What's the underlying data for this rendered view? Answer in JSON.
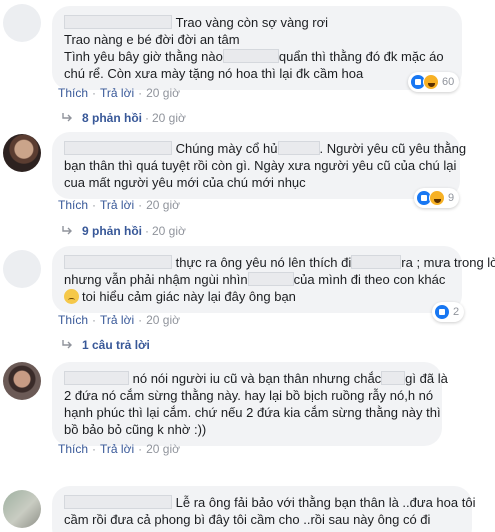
{
  "colors": {
    "link": "#385898",
    "meta": "#90949c",
    "bubble": "#f2f3f5",
    "like_blue": "#1877f2",
    "haha_yellow": "#f7b125"
  },
  "comments": [
    {
      "lines": [
        "Trao vàng còn sợ vàng rơi",
        "Trao nàng e bé đời đời an tâm",
        "Tình yêu bây giờ thằng nào",
        "quẩn thì thằng đó đk mặc áo",
        "chú rể. Còn xưa mày tặng nó hoa thì lại đk cầm hoa"
      ],
      "like": "Thích",
      "reply": "Trả lời",
      "time": "20 giờ",
      "reactions": "60",
      "replies_label": "8 phản hồi",
      "replies_time": "20 giờ"
    },
    {
      "lines": [
        "Chúng mày cổ hủ",
        ". Người yêu cũ yêu thằng",
        "bạn thân thì quá tuyệt rồi còn gì. Ngày xưa người yêu cũ của chú lại",
        "cua mất người yêu mới của chú mới nhục"
      ],
      "like": "Thích",
      "reply": "Trả lời",
      "time": "20 giờ",
      "reactions": "9",
      "replies_label": "9 phản hồi",
      "replies_time": "20 giờ"
    },
    {
      "lines": [
        "thực ra ông yêu nó lên thích đi",
        "ra ; mưa trong lòng",
        "nhưng vẫn phải nhậm ngùi nhìn",
        "của mình đi theo con khác",
        "toi hiểu cảm giác này lại đây ông bạn"
      ],
      "like": "Thích",
      "reply": "Trả lời",
      "time": "20 giờ",
      "reactions": "2",
      "replies_label": "1 câu trả lời"
    },
    {
      "lines": [
        "nó nói người iu cũ và bạn thân nhưng chắc",
        "gì đã là",
        "2 đứa nó cắm sừng thằng này. hay lại bồ bịch ruồng rẫy nó,h nó",
        "hạnh phúc thì lại cắm. chứ nếu 2 đứa kia cắm sừng thằng này thì",
        "bồ bảo bỏ cũng k nhờ :))"
      ],
      "like": "Thích",
      "reply": "Trả lời",
      "time": "20 giờ"
    },
    {
      "lines": [
        "Lễ ra ông fải bảo với thằng bạn thân là ..đưa hoa tôi",
        "cầm rồi đưa cả phong bì đây tôi cầm cho ..rồi sau này ông có đi"
      ]
    }
  ]
}
